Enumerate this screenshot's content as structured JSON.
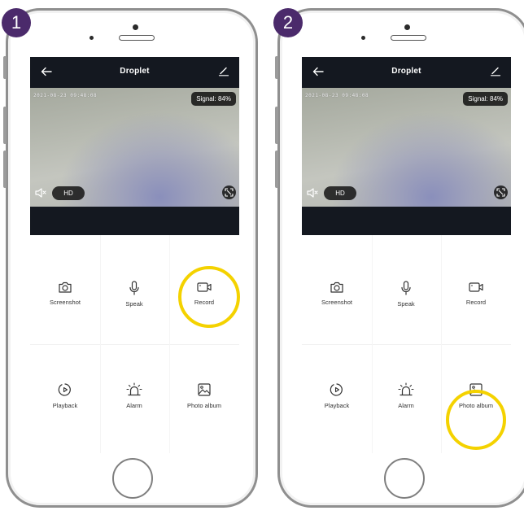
{
  "steps": [
    {
      "number": "1",
      "app_bar": {
        "title": "Droplet",
        "back_icon": "arrow-left-icon",
        "edit_icon": "pencil-icon"
      },
      "video": {
        "timestamp": "2021-08-23 09:48:08",
        "signal": "Signal: 84%",
        "quality": "HD",
        "mute_icon": "speaker-muted-icon",
        "expand_icon": "fullscreen-icon"
      },
      "controls": [
        {
          "label": "Screenshot",
          "icon": "camera-icon"
        },
        {
          "label": "Speak",
          "icon": "microphone-icon"
        },
        {
          "label": "Record",
          "icon": "video-camera-icon"
        },
        {
          "label": "Playback",
          "icon": "playback-icon"
        },
        {
          "label": "Alarm",
          "icon": "siren-icon"
        },
        {
          "label": "Photo album",
          "icon": "image-icon"
        }
      ],
      "highlighted": "Record"
    },
    {
      "number": "2",
      "app_bar": {
        "title": "Droplet",
        "back_icon": "arrow-left-icon",
        "edit_icon": "pencil-icon"
      },
      "video": {
        "timestamp": "2021-08-23 09:48:08",
        "signal": "Signal: 84%",
        "quality": "HD",
        "mute_icon": "speaker-muted-icon",
        "expand_icon": "fullscreen-icon"
      },
      "controls": [
        {
          "label": "Screenshot",
          "icon": "camera-icon"
        },
        {
          "label": "Speak",
          "icon": "microphone-icon"
        },
        {
          "label": "Record",
          "icon": "video-camera-icon"
        },
        {
          "label": "Playback",
          "icon": "playback-icon"
        },
        {
          "label": "Alarm",
          "icon": "siren-icon"
        },
        {
          "label": "Photo album",
          "icon": "image-icon"
        }
      ],
      "highlighted": "Photo album"
    }
  ],
  "colors": {
    "badge": "#4b2a6b",
    "highlight": "#f4d200",
    "app_bar": "#141820",
    "phone_frame": "#8f8f8f"
  }
}
